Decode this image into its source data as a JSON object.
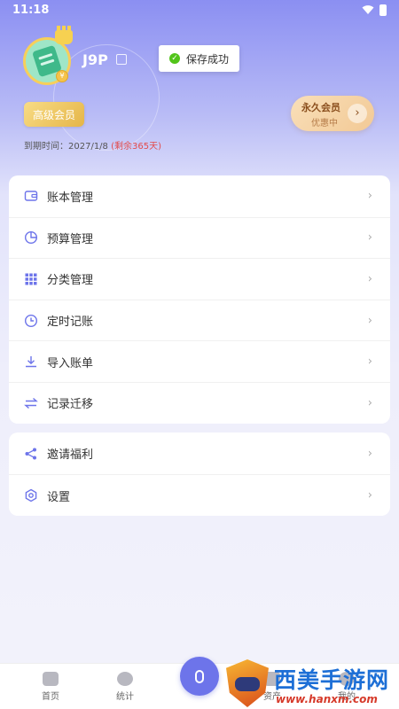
{
  "status_bar": {
    "time": "11:18"
  },
  "profile": {
    "username": "J9P",
    "vip_badge": "高级会员",
    "expire_label": "到期时间：2027/1/8",
    "expire_remaining": "(剩余365天)"
  },
  "toast": {
    "text": "保存成功"
  },
  "lifetime_card": {
    "title": "永久会员",
    "subtitle": "优惠中"
  },
  "menu_primary": [
    {
      "label": "账本管理",
      "icon": "wallet-icon"
    },
    {
      "label": "预算管理",
      "icon": "pie-chart-icon"
    },
    {
      "label": "分类管理",
      "icon": "grid-icon"
    },
    {
      "label": "定时记账",
      "icon": "clock-icon"
    },
    {
      "label": "导入账单",
      "icon": "download-icon"
    },
    {
      "label": "记录迁移",
      "icon": "transfer-icon"
    }
  ],
  "menu_secondary": [
    {
      "label": "邀请福利",
      "icon": "share-icon"
    },
    {
      "label": "设置",
      "icon": "gear-icon"
    }
  ],
  "tabbar": {
    "tabs": [
      {
        "label": "首页"
      },
      {
        "label": "统计"
      },
      {
        "label": "资产"
      },
      {
        "label": "我的"
      }
    ]
  },
  "watermark": {
    "brand": "西美手游网",
    "url": "www.hanxm.com"
  },
  "colors": {
    "accent": "#6d74ea",
    "gold": "#e5b547",
    "remain": "#e34b4b"
  }
}
